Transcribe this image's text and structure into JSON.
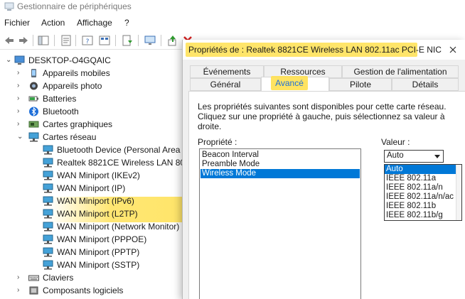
{
  "window": {
    "title": "Gestionnaire de périphériques"
  },
  "menu": [
    "Fichier",
    "Action",
    "Affichage",
    "?"
  ],
  "toolbar": {
    "icons": [
      "back-arrow-icon",
      "forward-arrow-icon",
      "show-hide-console-tree-icon",
      "properties-icon",
      "help-icon",
      "view-icon",
      "scan-hardware-icon",
      "update-driver-icon",
      "uninstall-icon",
      "disable-icon"
    ]
  },
  "tree": {
    "root": "DESKTOP-O4GQAIC",
    "categories": [
      {
        "label": "Appareils mobiles",
        "icon": "phone-icon",
        "expanded": false
      },
      {
        "label": "Appareils photo",
        "icon": "camera-icon",
        "expanded": false
      },
      {
        "label": "Batteries",
        "icon": "battery-icon",
        "expanded": false
      },
      {
        "label": "Bluetooth",
        "icon": "bluetooth-icon",
        "expanded": false
      },
      {
        "label": "Cartes graphiques",
        "icon": "display-adapter-icon",
        "expanded": false
      },
      {
        "label": "Cartes réseau",
        "icon": "network-adapter-icon",
        "expanded": true
      }
    ],
    "network_adapters": [
      "Bluetooth Device (Personal Area N",
      "Realtek 8821CE Wireless LAN 802.",
      "WAN Miniport (IKEv2)",
      "WAN Miniport (IP)",
      "WAN Miniport (IPv6)",
      "WAN Miniport (L2TP)",
      "WAN Miniport (Network Monitor)",
      "WAN Miniport (PPPOE)",
      "WAN Miniport (PPTP)",
      "WAN Miniport (SSTP)"
    ],
    "after": [
      {
        "label": "Claviers",
        "icon": "keyboard-icon"
      },
      {
        "label": "Composants logiciels",
        "icon": "software-component-icon"
      }
    ]
  },
  "dialog": {
    "title": "Propriétés de : Realtek 8821CE Wireless LAN 802.11ac PCI-E NIC",
    "tabs_row1": [
      "Événements",
      "Ressources",
      "Gestion de l'alimentation"
    ],
    "tabs_row2": [
      "Général",
      "Avancé",
      "Pilote",
      "Détails"
    ],
    "active_tab": "Avancé",
    "description": "Les propriétés suivantes sont disponibles pour cette carte réseau. Cliquez sur une propriété à gauche, puis sélectionnez sa valeur à droite.",
    "property_label": "Propriété :",
    "value_label": "Valeur :",
    "properties": [
      "Beacon Interval",
      "Preamble Mode",
      "Wireless Mode"
    ],
    "selected_property": "Wireless Mode",
    "selected_value": "Auto",
    "value_options": [
      "Auto",
      "IEEE 802.11a",
      "IEEE 802.11a/n",
      "IEEE 802.11a/n/ac",
      "IEEE 802.11b",
      "IEEE 802.11b/g"
    ]
  },
  "colors": {
    "selection": "#0078d7",
    "highlight": "#ffe050"
  }
}
